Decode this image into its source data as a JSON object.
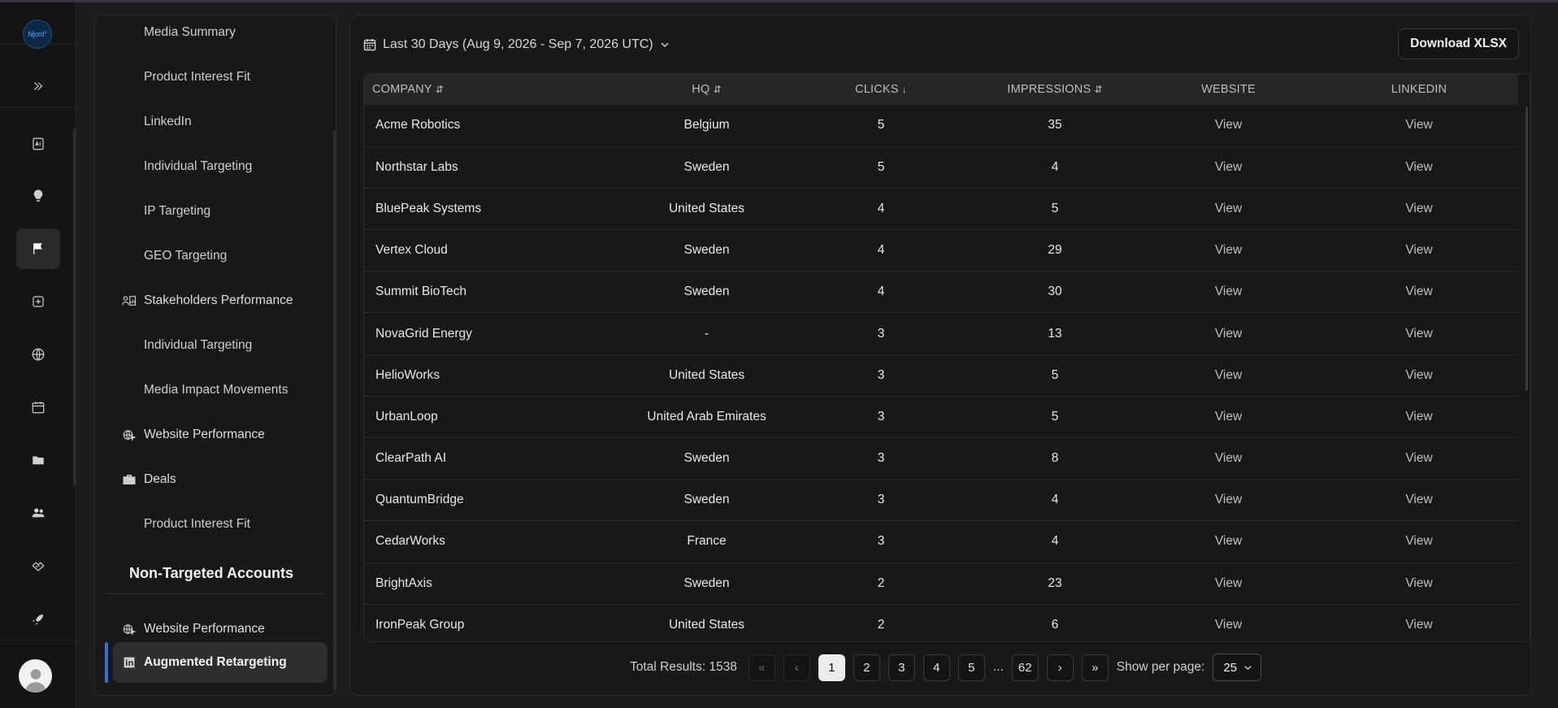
{
  "brand": {
    "logo_text": "Njord°"
  },
  "sidebar": {
    "items": [
      {
        "label": "Media Summary",
        "kind": "sub"
      },
      {
        "label": "Product Interest Fit",
        "kind": "sub"
      },
      {
        "label": "LinkedIn",
        "kind": "sub"
      },
      {
        "label": "Individual Targeting",
        "kind": "sub"
      },
      {
        "label": "IP Targeting",
        "kind": "sub"
      },
      {
        "label": "GEO Targeting",
        "kind": "sub"
      },
      {
        "label": "Stakeholders Performance",
        "kind": "head",
        "icon": "stakeholders-icon"
      },
      {
        "label": "Individual Targeting",
        "kind": "sub"
      },
      {
        "label": "Media Impact Movements",
        "kind": "sub"
      },
      {
        "label": "Website Performance",
        "kind": "head",
        "icon": "globe-cursor-icon"
      },
      {
        "label": "Deals",
        "kind": "head",
        "icon": "briefcase-icon"
      },
      {
        "label": "Product Interest Fit",
        "kind": "sub"
      }
    ],
    "section_title": "Non-Targeted Accounts",
    "section_items": [
      {
        "label": "Website Performance",
        "icon": "globe-cursor-icon"
      },
      {
        "label": "Augmented Retargeting",
        "icon": "linkedin-icon",
        "active": true
      }
    ]
  },
  "filter": {
    "date_range": "Last 30 Days (Aug 9, 2026 - Sep 7, 2026 UTC)"
  },
  "toolbar": {
    "download_label": "Download XLSX"
  },
  "table": {
    "columns": [
      {
        "label": "COMPANY",
        "sort": "⇵"
      },
      {
        "label": "HQ",
        "sort": "⇵"
      },
      {
        "label": "CLICKS",
        "sort": "↓"
      },
      {
        "label": "IMPRESSIONS",
        "sort": "⇵"
      },
      {
        "label": "WEBSITE",
        "sort": ""
      },
      {
        "label": "LINKEDIN",
        "sort": ""
      }
    ],
    "rows": [
      {
        "company": "Acme Robotics",
        "hq": "Belgium",
        "clicks": "5",
        "impressions": "35",
        "website": "View",
        "linkedin": "View"
      },
      {
        "company": "Northstar Labs",
        "hq": "Sweden",
        "clicks": "5",
        "impressions": "4",
        "website": "View",
        "linkedin": "View"
      },
      {
        "company": "BluePeak Systems",
        "hq": "United States",
        "clicks": "4",
        "impressions": "5",
        "website": "View",
        "linkedin": "View"
      },
      {
        "company": "Vertex Cloud",
        "hq": "Sweden",
        "clicks": "4",
        "impressions": "29",
        "website": "View",
        "linkedin": "View"
      },
      {
        "company": "Summit BioTech",
        "hq": "Sweden",
        "clicks": "4",
        "impressions": "30",
        "website": "View",
        "linkedin": "View"
      },
      {
        "company": "NovaGrid Energy",
        "hq": "-",
        "clicks": "3",
        "impressions": "13",
        "website": "View",
        "linkedin": "View"
      },
      {
        "company": "HelioWorks",
        "hq": "United States",
        "clicks": "3",
        "impressions": "5",
        "website": "View",
        "linkedin": "View"
      },
      {
        "company": "UrbanLoop",
        "hq": "United Arab Emirates",
        "clicks": "3",
        "impressions": "5",
        "website": "View",
        "linkedin": "View"
      },
      {
        "company": "ClearPath AI",
        "hq": "Sweden",
        "clicks": "3",
        "impressions": "8",
        "website": "View",
        "linkedin": "View"
      },
      {
        "company": "QuantumBridge",
        "hq": "Sweden",
        "clicks": "3",
        "impressions": "4",
        "website": "View",
        "linkedin": "View"
      },
      {
        "company": "CedarWorks",
        "hq": "France",
        "clicks": "3",
        "impressions": "4",
        "website": "View",
        "linkedin": "View"
      },
      {
        "company": "BrightAxis",
        "hq": "Sweden",
        "clicks": "2",
        "impressions": "23",
        "website": "View",
        "linkedin": "View"
      },
      {
        "company": "IronPeak Group",
        "hq": "United States",
        "clicks": "2",
        "impressions": "6",
        "website": "View",
        "linkedin": "View"
      }
    ]
  },
  "pagination": {
    "total_label": "Total Results: 1538",
    "pages": [
      "1",
      "2",
      "3",
      "4",
      "5"
    ],
    "ellipsis": "...",
    "last_page": "62",
    "current": "1",
    "per_page_label": "Show per page:",
    "per_page_value": "25",
    "first_glyph": "«",
    "prev_glyph": "‹",
    "next_glyph": "›",
    "last_glyph": "»"
  }
}
